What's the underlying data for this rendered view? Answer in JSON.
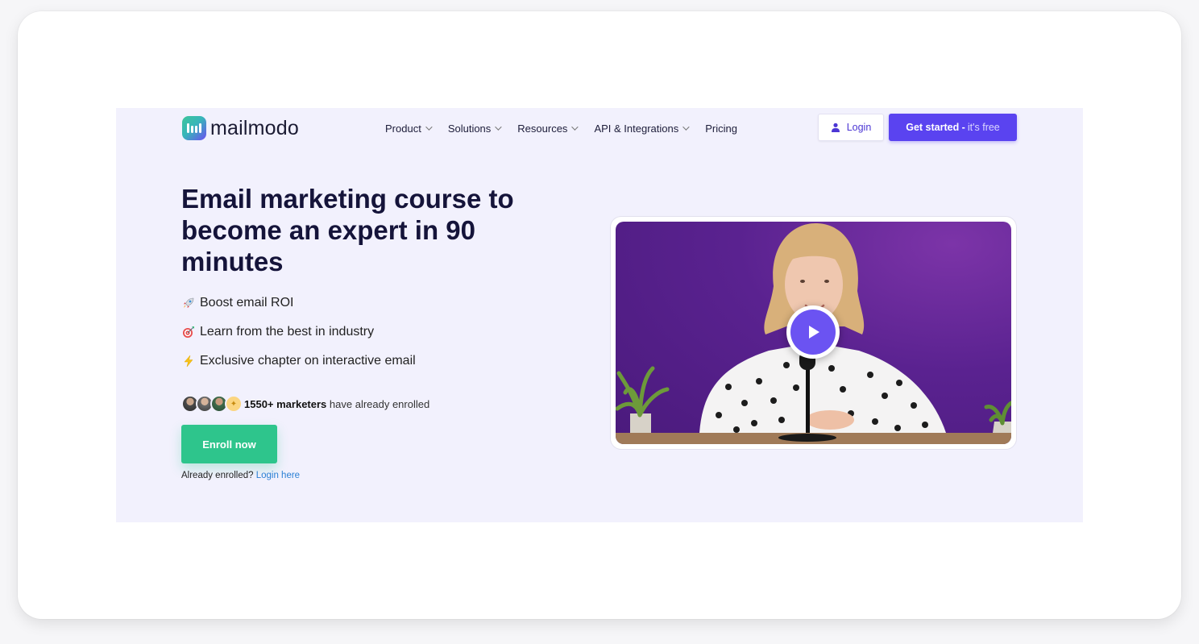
{
  "brand": {
    "name": "mailmodo",
    "accent": "#5a43f0",
    "green": "#2ec58c"
  },
  "nav": {
    "items": [
      {
        "label": "Product",
        "dropdown": true
      },
      {
        "label": "Solutions",
        "dropdown": true
      },
      {
        "label": "Resources",
        "dropdown": true
      },
      {
        "label": "API & Integrations",
        "dropdown": true
      },
      {
        "label": "Pricing",
        "dropdown": false
      }
    ],
    "login_label": "Login",
    "get_started_bold": "Get started -",
    "get_started_light": "it's free"
  },
  "hero": {
    "headline": "Email marketing course to become an expert in 90 minutes",
    "features": [
      {
        "icon": "rocket-icon",
        "text": "Boost email ROI"
      },
      {
        "icon": "target-icon",
        "text": "Learn from the best in industry"
      },
      {
        "icon": "lightning-icon",
        "text": "Exclusive chapter on interactive email"
      }
    ],
    "social_count": "1550+ marketers",
    "social_rest": "have already enrolled",
    "enroll_label": "Enroll now",
    "already_text": "Already enrolled?",
    "login_here": "Login here"
  }
}
